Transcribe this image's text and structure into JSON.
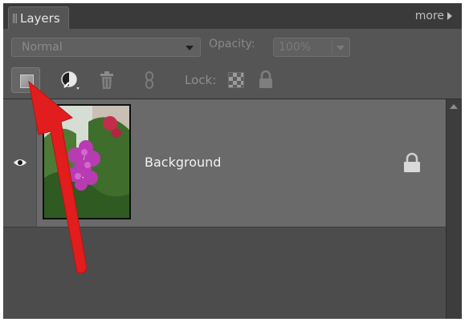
{
  "panel": {
    "tab_label": "Layers",
    "more_label": "more"
  },
  "options": {
    "blend_mode": "Normal",
    "opacity_label": "Opacity:",
    "opacity_value": "100%"
  },
  "toolbar": {
    "lock_label": "Lock:",
    "icons": [
      "new-layer-icon",
      "adjustment-layer-icon",
      "trash-icon",
      "link-icon",
      "lock-transparency-icon",
      "lock-all-icon"
    ]
  },
  "layers": [
    {
      "name": "Background",
      "visible": true,
      "locked": true
    }
  ],
  "colors": {
    "panel_bg": "#4c4c4c",
    "selected_row": "#6a6a6a",
    "annotation_arrow": "#e21d1d"
  }
}
